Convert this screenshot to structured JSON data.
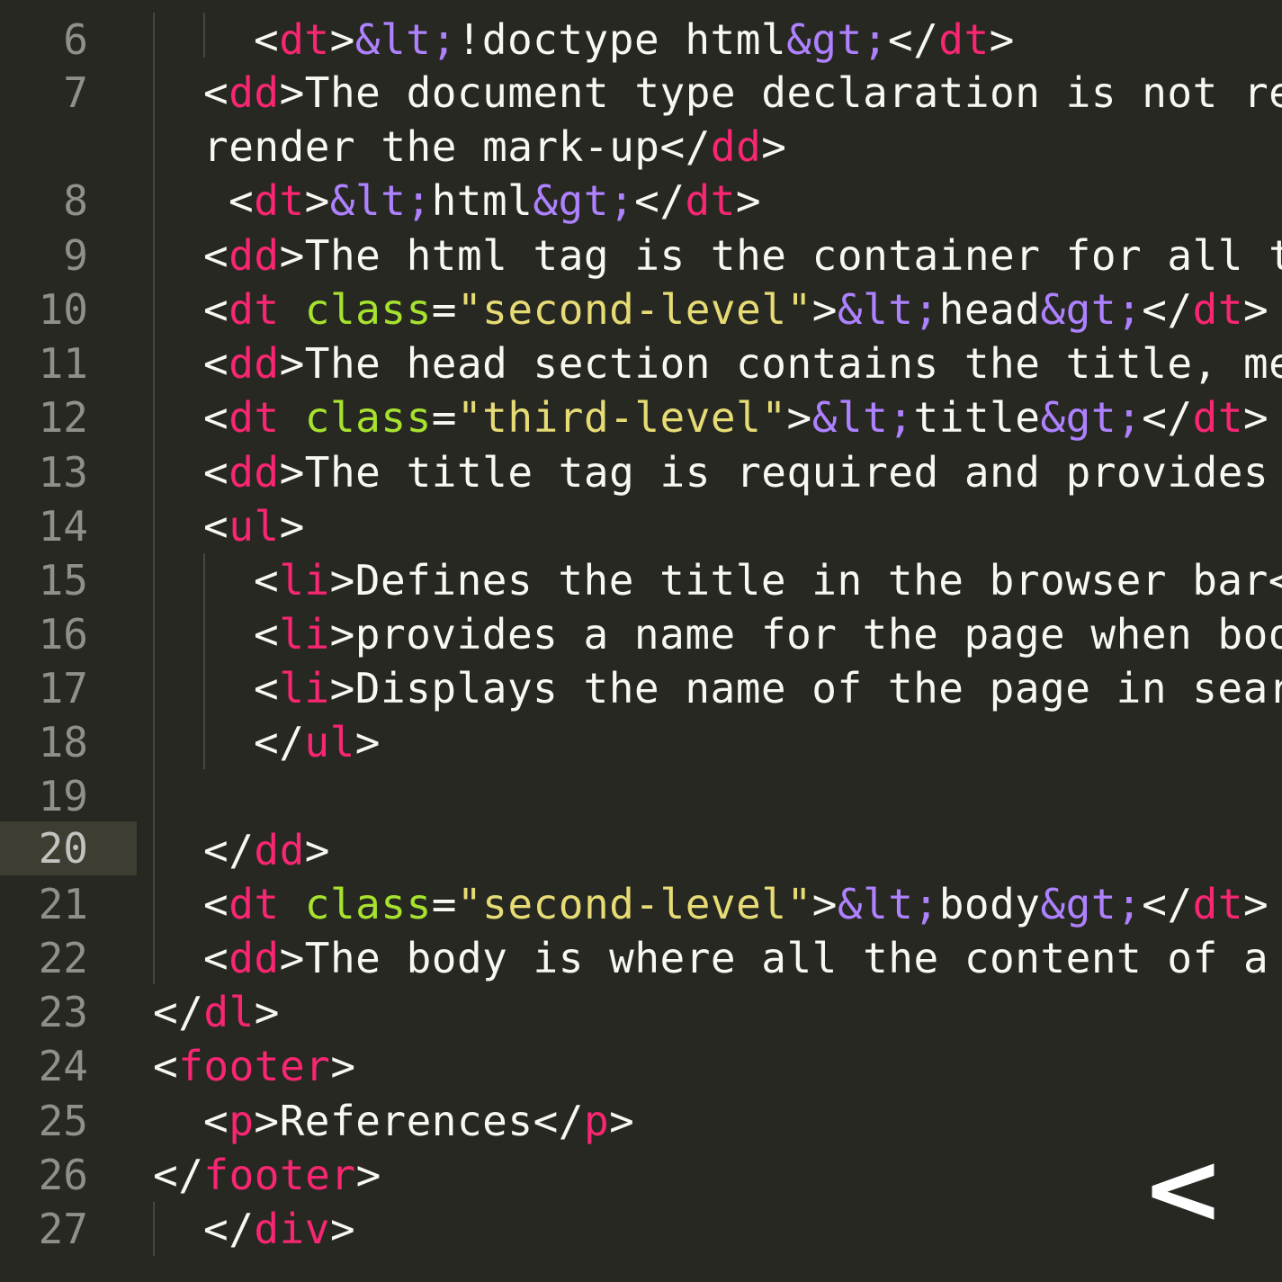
{
  "gutter": {
    "line_numbers": [
      "6",
      "7",
      "8",
      "9",
      "10",
      "11",
      "12",
      "13",
      "14",
      "15",
      "16",
      "17",
      "18",
      "19",
      "20",
      "21",
      "22",
      "23",
      "24",
      "25",
      "26",
      "27"
    ],
    "active_line": "20"
  },
  "code": {
    "l6": {
      "o1": "<",
      "tag": "dt",
      "c1": ">",
      "ent1": "&lt;",
      "text": "!doctype html",
      "ent2": "&gt;",
      "o2": "</",
      "tag2": "dt",
      "c2": ">"
    },
    "l7": {
      "o1": "<",
      "tag": "dd",
      "c1": ">",
      "text": "The document type declaration is not rea"
    },
    "l7w": {
      "text": "render the mark-up",
      "o2": "</",
      "tag2": "dd",
      "c2": ">"
    },
    "l8": {
      "o1": "<",
      "tag": "dt",
      "c1": ">",
      "ent1": "&lt;",
      "text": "html",
      "ent2": "&gt;",
      "o2": "</",
      "tag2": "dt",
      "c2": ">"
    },
    "l9": {
      "o1": "<",
      "tag": "dd",
      "c1": ">",
      "text": "The html tag is the container for all th"
    },
    "l10": {
      "o1": "<",
      "tag": "dt",
      "sp": " ",
      "attr": "class",
      "eq": "=",
      "val": "\"second-level\"",
      "c1": ">",
      "ent1": "&lt;",
      "text": "head",
      "ent2": "&gt;",
      "o2": "</",
      "tag2": "dt",
      "c2": ">"
    },
    "l11": {
      "o1": "<",
      "tag": "dd",
      "c1": ">",
      "text": "The head section contains the title, met"
    },
    "l12": {
      "o1": "<",
      "tag": "dt",
      "sp": " ",
      "attr": "class",
      "eq": "=",
      "val": "\"third-level\"",
      "c1": ">",
      "ent1": "&lt;",
      "text": "title",
      "ent2": "&gt;",
      "o2": "</",
      "tag2": "dt",
      "c2": ">"
    },
    "l13": {
      "o1": "<",
      "tag": "dd",
      "c1": ">",
      "text": "The title tag is required and provides a"
    },
    "l14": {
      "o1": "<",
      "tag": "ul",
      "c1": ">"
    },
    "l15": {
      "o1": "<",
      "tag": "li",
      "c1": ">",
      "text": "Defines the title in the browser bar</"
    },
    "l16": {
      "o1": "<",
      "tag": "li",
      "c1": ">",
      "text": "provides a name for the page when book"
    },
    "l17": {
      "o1": "<",
      "tag": "li",
      "c1": ">",
      "text": "Displays the name of the page in searc"
    },
    "l18": {
      "o1": "</",
      "tag": "ul",
      "c1": ">"
    },
    "l20": {
      "o1": "</",
      "tag": "dd",
      "c1": ">"
    },
    "l21": {
      "o1": "<",
      "tag": "dt",
      "sp": " ",
      "attr": "class",
      "eq": "=",
      "val": "\"second-level\"",
      "c1": ">",
      "ent1": "&lt;",
      "text": "body",
      "ent2": "&gt;",
      "o2": "</",
      "tag2": "dt",
      "c2": ">"
    },
    "l22": {
      "o1": "<",
      "tag": "dd",
      "c1": ">",
      "text": "The body is where all the content of a w"
    },
    "l23": {
      "o1": "</",
      "tag": "dl",
      "c1": ">"
    },
    "l24": {
      "o1": "<",
      "tag": "footer",
      "c1": ">"
    },
    "l25": {
      "o1": "<",
      "tag": "p",
      "c1": ">",
      "text": "References",
      "o2": "</",
      "tag2": "p",
      "c2": ">"
    },
    "l26": {
      "o1": "</",
      "tag": "footer",
      "c1": ">"
    },
    "l27": {
      "o1": "</",
      "tag": "div",
      "c1": ">"
    }
  },
  "overlay": {
    "glyph": "<"
  },
  "colors": {
    "background": "#272822",
    "tag": "#f92672",
    "attribute": "#a6e22e",
    "string": "#e6db74",
    "entity": "#ae81ff",
    "text": "#f8f8f2",
    "gutter_text": "#90908a",
    "active_line": "#3e3d32"
  }
}
